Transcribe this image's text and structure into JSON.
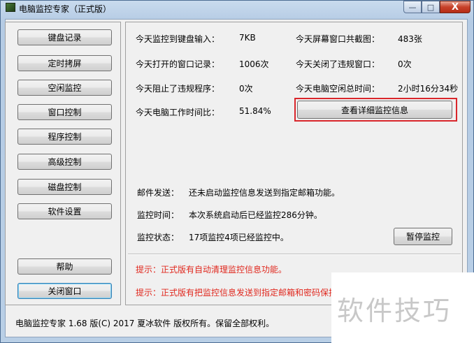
{
  "window": {
    "title": "电脑监控专家（正式版）",
    "controls": {
      "minimize": "—",
      "maximize": "□",
      "close": "X"
    }
  },
  "nav": {
    "items": [
      {
        "label": "键盘记录",
        "name": "nav-keyboard-log"
      },
      {
        "label": "定时拷屏",
        "name": "nav-timed-screenshot"
      },
      {
        "label": "空闲监控",
        "name": "nav-idle-monitor"
      },
      {
        "label": "窗口控制",
        "name": "nav-window-control"
      },
      {
        "label": "程序控制",
        "name": "nav-program-control"
      },
      {
        "label": "高级控制",
        "name": "nav-advanced-control"
      },
      {
        "label": "磁盘控制",
        "name": "nav-disk-control"
      },
      {
        "label": "软件设置",
        "name": "nav-software-settings"
      }
    ],
    "help": "帮助",
    "close_window": "关闭窗口"
  },
  "stats": {
    "keyboard_input_label": "今天监控到键盘输入：",
    "keyboard_input_value": "7KB",
    "screenshots_label": "今天屏幕窗口共截图：",
    "screenshots_value": "483张",
    "windows_opened_label": "今天打开的窗口记录：",
    "windows_opened_value": "1006次",
    "violations_closed_label": "今天关闭了违规窗口：",
    "violations_closed_value": "0次",
    "programs_blocked_label": "今天阻止了违规程序：",
    "programs_blocked_value": "0次",
    "idle_time_label": "今天电脑空闲总时间：",
    "idle_time_value": "2小时16分34秒",
    "work_ratio_label": "今天电脑工作时间比：",
    "work_ratio_value": "51.84%",
    "details_button": "查看详细监控信息"
  },
  "info": {
    "mail_label": "邮件发送：",
    "mail_value": "还未启动监控信息发送到指定邮箱功能。",
    "time_label": "监控时间：",
    "time_value": "本次系统启动后已经监控286分钟。",
    "state_label": "监控状态：",
    "state_value": "17项监控4项已经监控中。",
    "pause_button": "暂停监控"
  },
  "tips": {
    "tip1": "提示：正式版有自动清理监控信息功能。",
    "tip2": "提示：正式版有把监控信息发送到指定邮箱和密码保护"
  },
  "statusbar": {
    "text": "电脑监控专家 1.68 版(C) 2017 夏冰软件 版权所有。保留全部权利。"
  },
  "watermark": "软件技巧",
  "colors": {
    "highlight": "#d9262b",
    "tip": "#e0281e"
  }
}
